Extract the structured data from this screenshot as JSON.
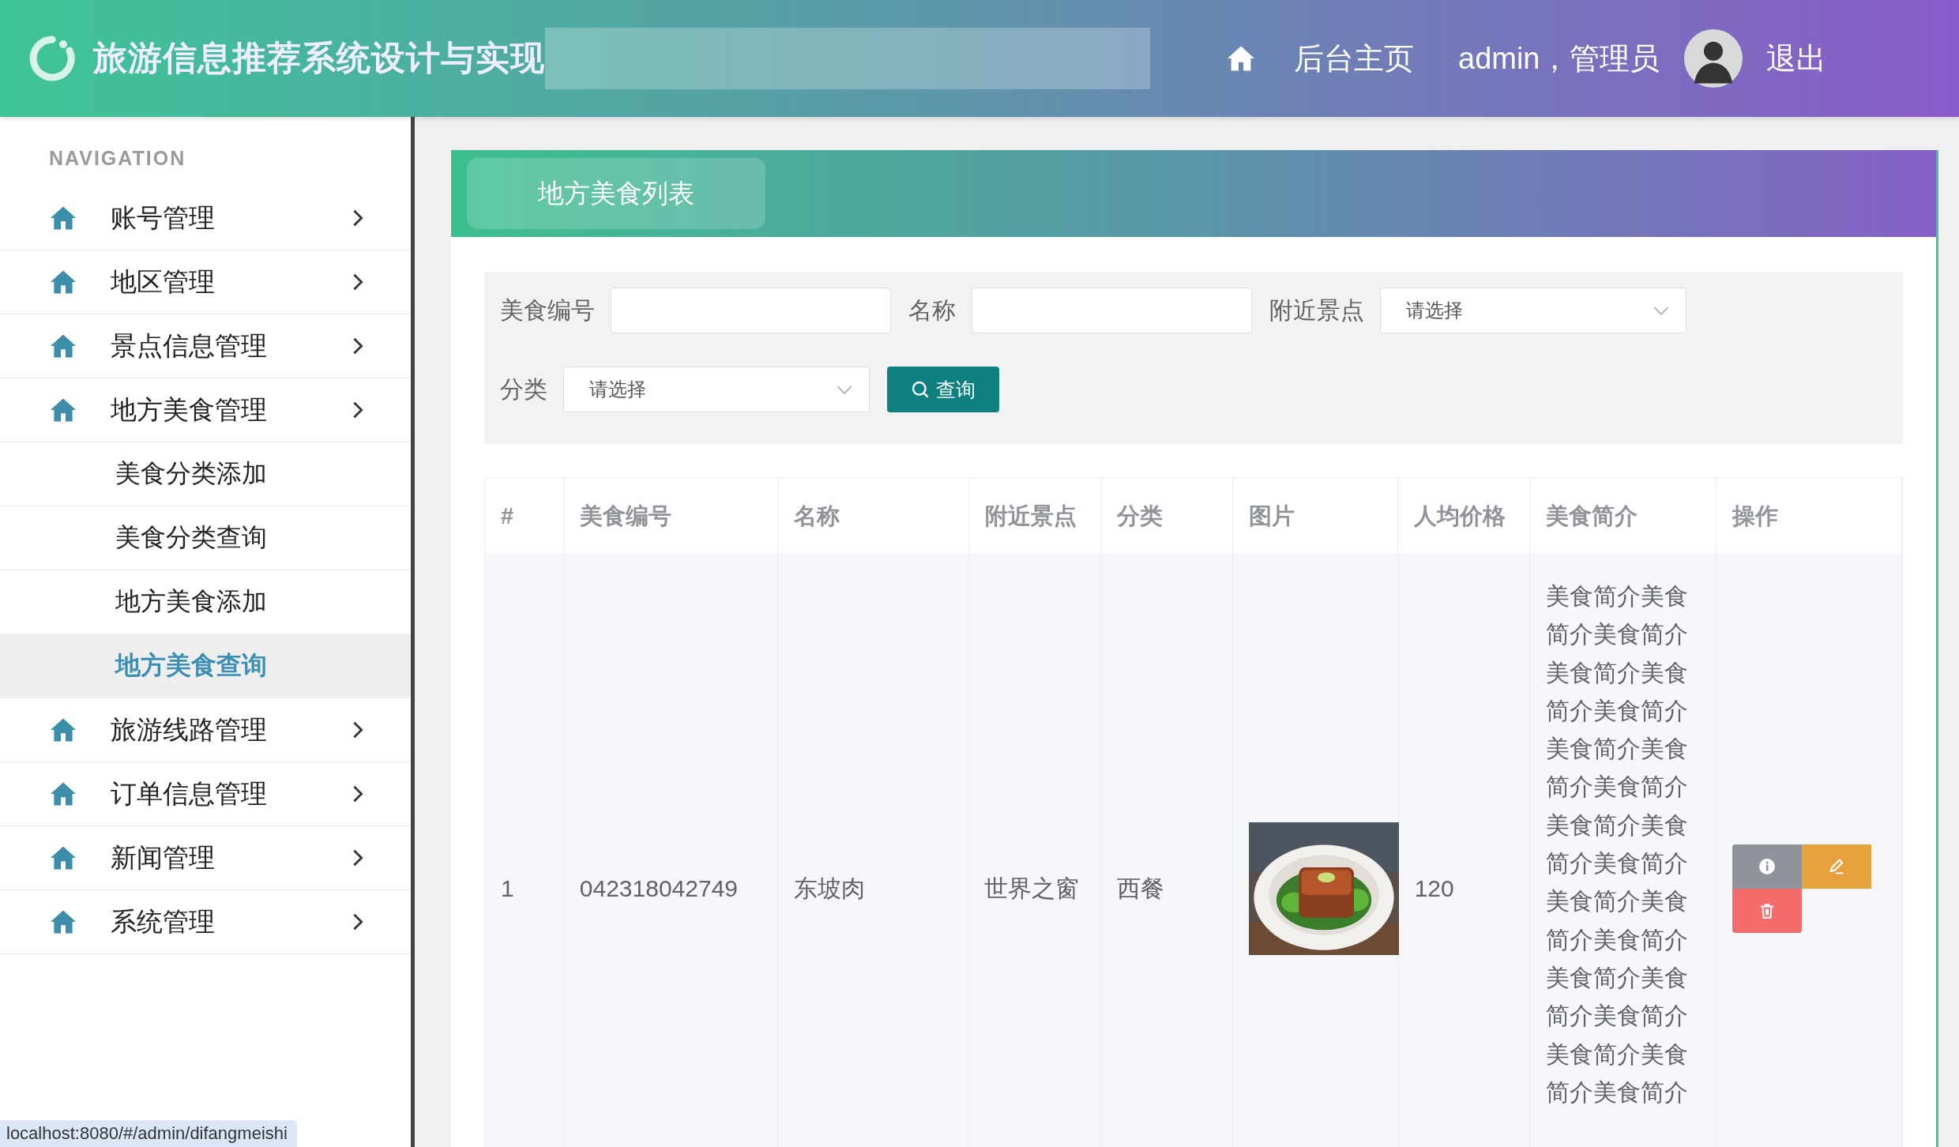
{
  "header": {
    "title": "旅游信息推荐系统设计与实现",
    "nav_home": "后台主页",
    "user": "admin，管理员",
    "logout": "退出"
  },
  "sidebar": {
    "heading": "NAVIGATION",
    "items": [
      {
        "label": "账号管理"
      },
      {
        "label": "地区管理"
      },
      {
        "label": "景点信息管理"
      },
      {
        "label": "地方美食管理",
        "children": [
          {
            "label": "美食分类添加",
            "selected": false
          },
          {
            "label": "美食分类查询",
            "selected": false
          },
          {
            "label": "地方美食添加",
            "selected": false
          },
          {
            "label": "地方美食查询",
            "selected": true
          }
        ]
      },
      {
        "label": "旅游线路管理"
      },
      {
        "label": "订单信息管理"
      },
      {
        "label": "新闻管理"
      },
      {
        "label": "系统管理"
      }
    ]
  },
  "panel": {
    "title": "地方美食列表"
  },
  "filters": {
    "fields": [
      {
        "kind": "input",
        "label": "美食编号"
      },
      {
        "kind": "input",
        "label": "名称"
      },
      {
        "kind": "select",
        "label": "附近景点",
        "placeholder": "请选择"
      },
      {
        "kind": "select",
        "label": "分类",
        "placeholder": "请选择"
      }
    ],
    "search_button": "查询"
  },
  "table": {
    "columns": [
      "#",
      "美食编号",
      "名称",
      "附近景点",
      "分类",
      "图片",
      "人均价格",
      "美食简介",
      "操作"
    ],
    "rows": [
      {
        "index": "1",
        "code": "042318042749",
        "name": "东坡肉",
        "nearby": "世界之窗",
        "category": "西餐",
        "price": "120",
        "description": "美食简介美食简介美食简介美食简介美食简介美食简介美食简介美食简介美食简介美食简介美食简介美食简介美食简介美食简介美食简介美食简介美食简介美食简介美食简介美食简介美食简介"
      }
    ]
  },
  "status_bar": "localhost:8080/#/admin/difangmeishi"
}
